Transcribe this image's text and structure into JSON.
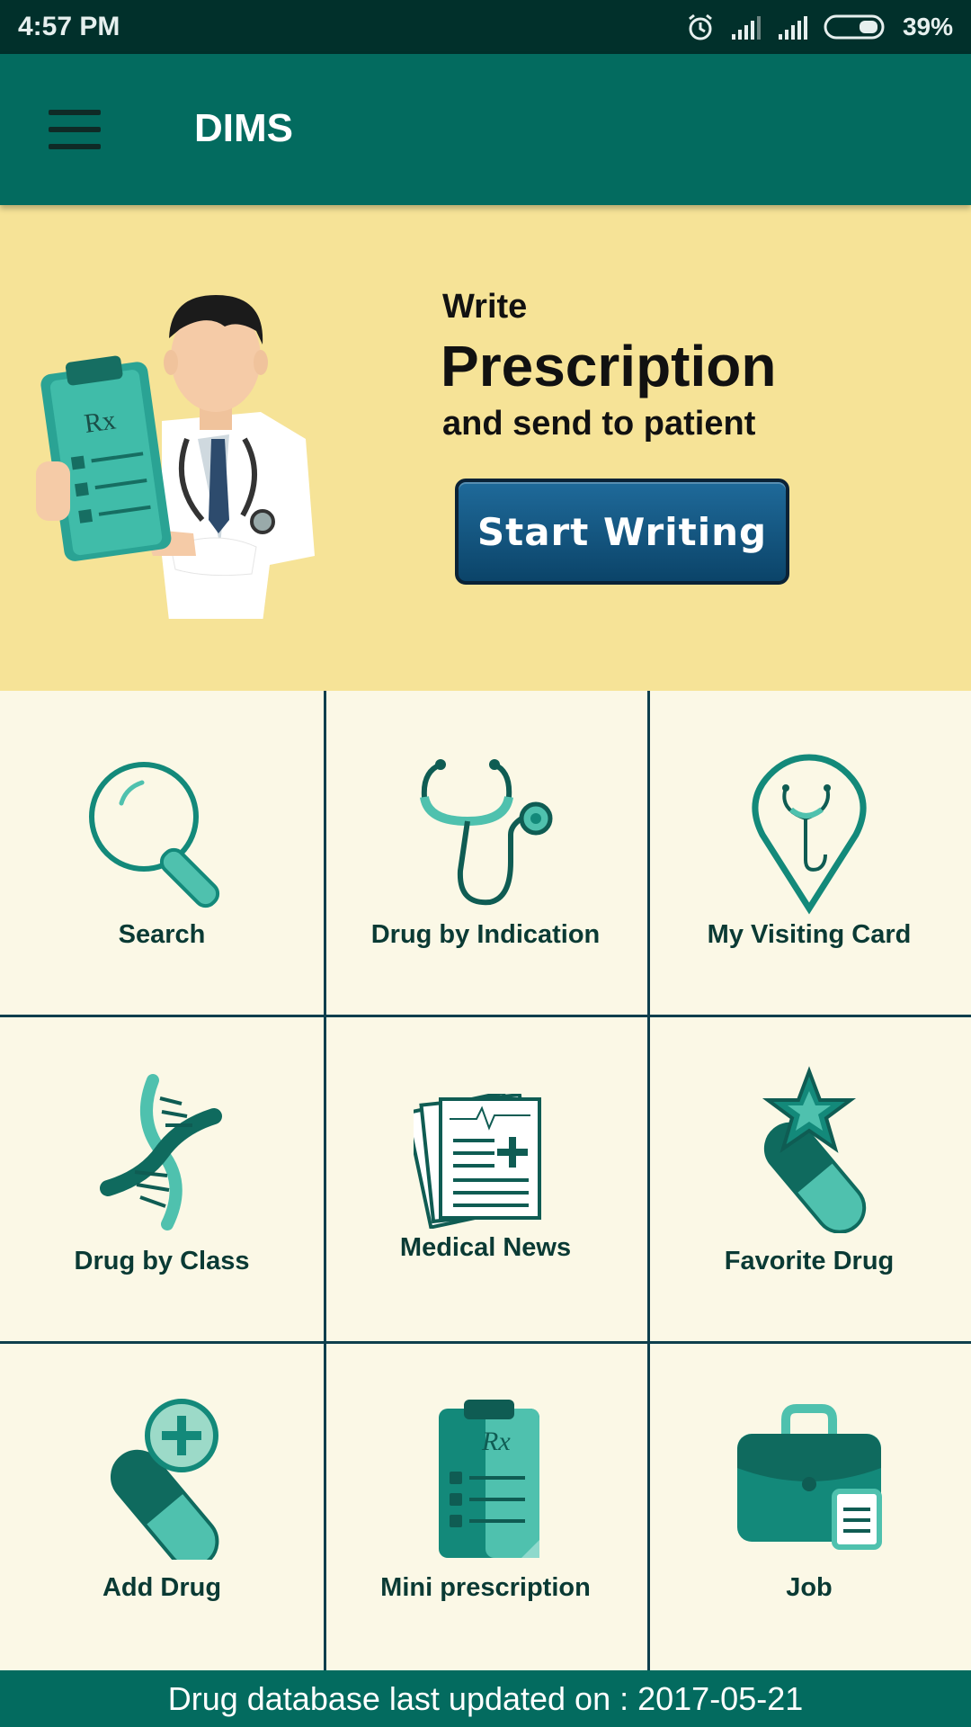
{
  "status_bar": {
    "time": "4:57 PM",
    "battery": "39%",
    "icons": [
      "alarm-icon",
      "signal-icon",
      "signal-icon",
      "battery-icon"
    ]
  },
  "app_bar": {
    "title": "DIMS",
    "menu_icon": "hamburger-menu-icon"
  },
  "banner": {
    "line1": "Write",
    "line2": "Prescription",
    "line3": "and send to patient",
    "button_label": "Start Writing",
    "illustration": "doctor-holding-prescription-icon"
  },
  "grid": {
    "items": [
      {
        "label": "Search",
        "icon": "search-icon"
      },
      {
        "label": "Drug by Indication",
        "icon": "stethoscope-icon"
      },
      {
        "label": "My Visiting Card",
        "icon": "location-stethoscope-icon"
      },
      {
        "label": "Drug by Class",
        "icon": "dna-icon"
      },
      {
        "label": "Medical News",
        "icon": "news-document-icon"
      },
      {
        "label": "Favorite Drug",
        "icon": "star-pill-icon"
      },
      {
        "label": "Add Drug",
        "icon": "add-pill-icon"
      },
      {
        "label": "Mini prescription",
        "icon": "clipboard-rx-icon"
      },
      {
        "label": "Job",
        "icon": "briefcase-icon"
      }
    ]
  },
  "footer": {
    "text": "Drug database last updated on : 2017-05-21"
  },
  "colors": {
    "primary": "#036b5f",
    "status_bar": "#01302b",
    "banner_bg": "#f6e397",
    "grid_bg": "#fbf8e6",
    "icon_teal": "#13897a",
    "button": "#0b4469"
  }
}
